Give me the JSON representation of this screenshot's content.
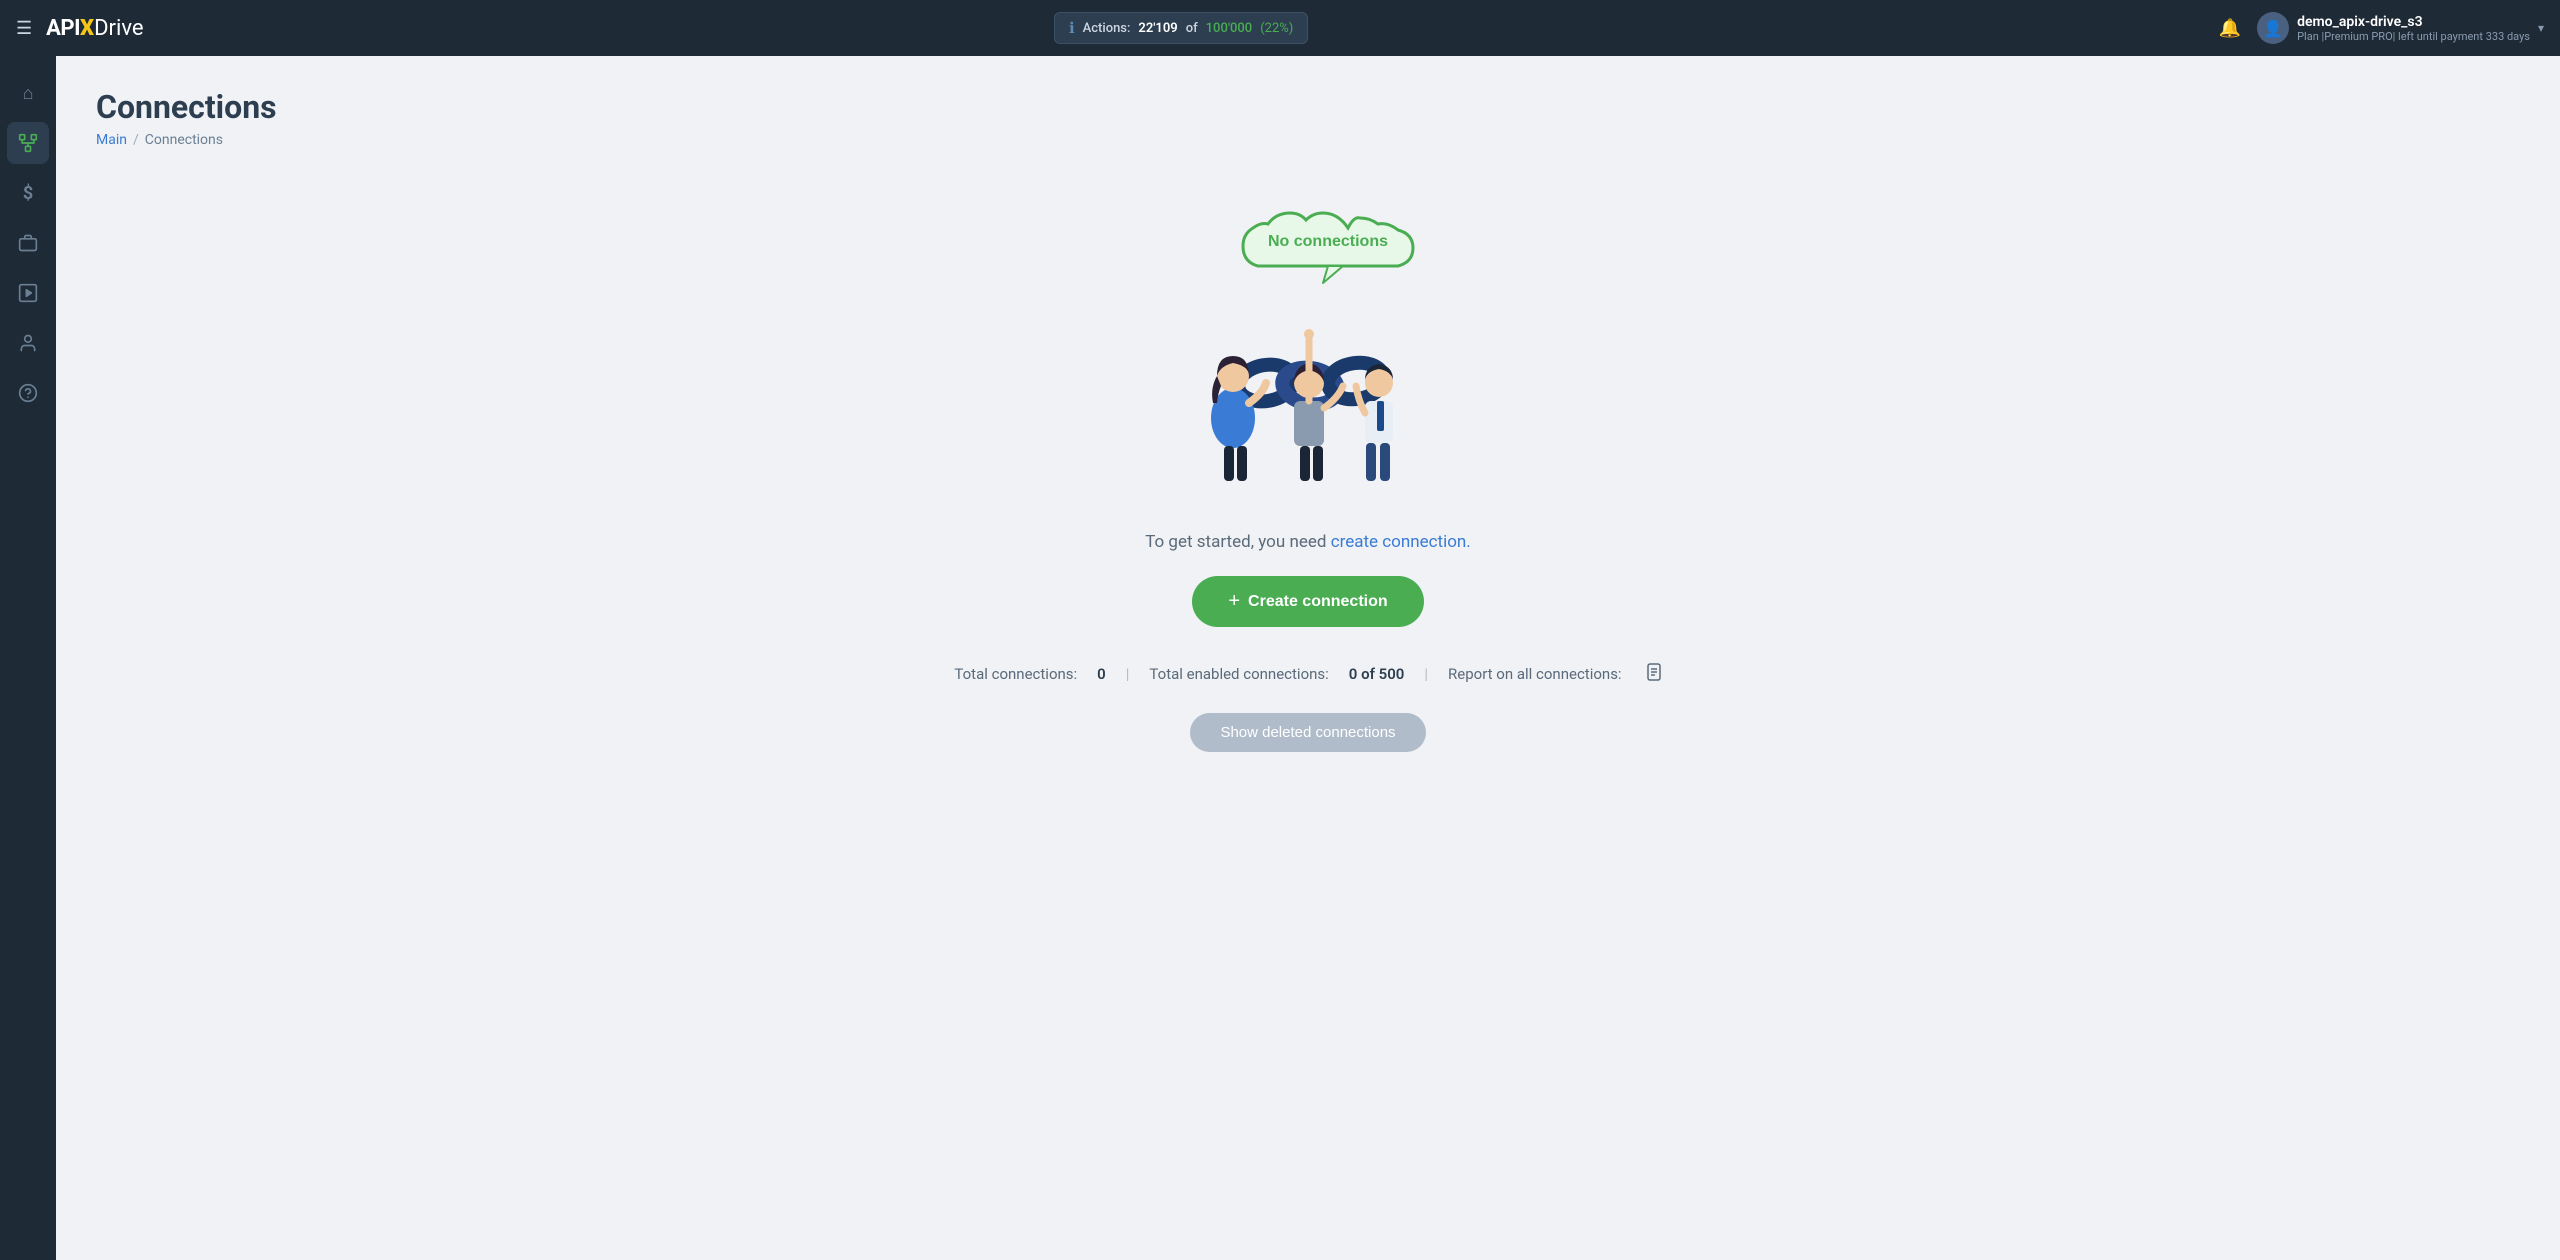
{
  "topnav": {
    "hamburger_icon": "☰",
    "logo": {
      "api": "API",
      "x": "X",
      "drive": "Drive"
    },
    "actions": {
      "label": "Actions:",
      "count": "22'109",
      "separator": "of",
      "total": "100'000",
      "percent": "(22%)"
    },
    "bell_icon": "🔔",
    "user": {
      "name": "demo_apix-drive_s3",
      "plan": "Plan |Premium PRO| left until payment",
      "days": "333 days",
      "avatar_icon": "👤"
    },
    "chevron": "▾"
  },
  "sidebar": {
    "items": [
      {
        "id": "home",
        "icon": "⌂",
        "active": false
      },
      {
        "id": "connections",
        "icon": "⚙",
        "active": true
      },
      {
        "id": "billing",
        "icon": "$",
        "active": false
      },
      {
        "id": "briefcase",
        "icon": "💼",
        "active": false
      },
      {
        "id": "video",
        "icon": "▶",
        "active": false
      },
      {
        "id": "profile",
        "icon": "👤",
        "active": false
      },
      {
        "id": "help",
        "icon": "?",
        "active": false
      }
    ]
  },
  "page": {
    "title": "Connections",
    "breadcrumb": {
      "home": "Main",
      "separator": "/",
      "current": "Connections"
    }
  },
  "illustration": {
    "cloud_text": "No connections"
  },
  "content": {
    "tagline_static": "To get started, you need",
    "tagline_link": "create connection.",
    "create_button": "+ Create connection",
    "create_button_plus": "+",
    "create_button_label": "Create connection",
    "stats": {
      "total_label": "Total connections:",
      "total_value": "0",
      "enabled_label": "Total enabled connections:",
      "enabled_value": "0 of 500",
      "report_label": "Report on all connections:"
    },
    "show_deleted_button": "Show deleted connections"
  }
}
